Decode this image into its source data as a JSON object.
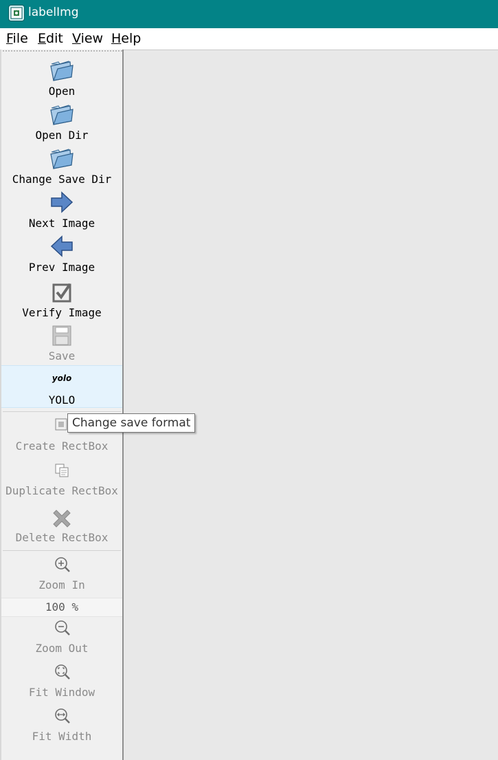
{
  "window": {
    "title": "labelImg"
  },
  "menu": [
    "File",
    "Edit",
    "View",
    "Help"
  ],
  "toolbar": {
    "open": "Open",
    "open_dir": "Open Dir",
    "change_save_dir": "Change Save Dir",
    "next_image": "Next Image",
    "prev_image": "Prev Image",
    "verify_image": "Verify Image",
    "save": "Save",
    "format_icon_text": "yolo",
    "format": "YOLO",
    "create_rectbox": "Create RectBox",
    "duplicate_rectbox": "Duplicate RectBox",
    "delete_rectbox": "Delete RectBox",
    "zoom_in": "Zoom In",
    "zoom_value": "100 %",
    "zoom_out": "Zoom Out",
    "fit_window": "Fit Window",
    "fit_width": "Fit Width"
  },
  "tooltip": "Change save format",
  "colors": {
    "titlebar": "#038387",
    "canvas": "#e8e8e8",
    "toolbar": "#f0f0f0",
    "highlight": "#e5f3fd"
  }
}
